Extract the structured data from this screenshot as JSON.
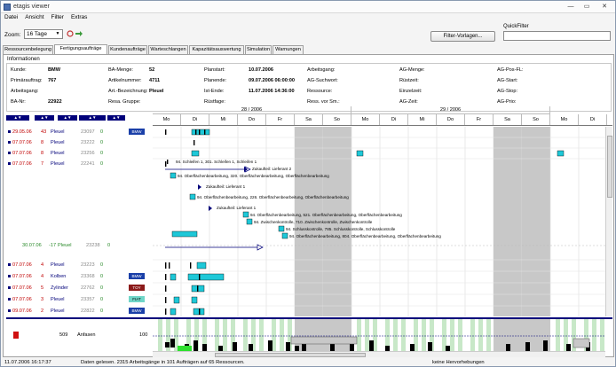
{
  "window": {
    "title": "etagis viewer",
    "min": "—",
    "max": "▭",
    "close": "✕"
  },
  "menu": [
    "Datei",
    "Ansicht",
    "Filter",
    "Extras"
  ],
  "toolbar": {
    "zoom_label": "Zoom:",
    "zoom_value": "16 Tage",
    "filter_button": "Filter-Vorlagen...",
    "quickfilter_label": "QuickFilter",
    "quickfilter_value": ""
  },
  "tabs": [
    "Ressourcenbelegung",
    "Fertigungsaufträge",
    "Kundenaufträge",
    "Warteschlangen",
    "Kapazitätsauswertung",
    "Simulation",
    "Warnungen"
  ],
  "active_tab": 1,
  "info": {
    "title": "Informationen",
    "col1": [
      {
        "label": "Kunde:",
        "value": "BMW"
      },
      {
        "label": "Primärauftrag:",
        "value": "767"
      },
      {
        "label": "Arbeitsgang:",
        "value": ""
      },
      {
        "label": "BA-Nr:",
        "value": "22922"
      }
    ],
    "col2": [
      {
        "label": "BA-Menge:",
        "value": "52"
      },
      {
        "label": "Artikelnummer:",
        "value": "4711"
      },
      {
        "label": "Art.-Bezeichnung:",
        "value": "Pleuel"
      },
      {
        "label": "Resa. Gruppe:",
        "value": ""
      }
    ],
    "col3": [
      {
        "label": "Planstart:",
        "value": "10.07.2006"
      },
      {
        "label": "Planende:",
        "value": "09.07.2006 06:00:00"
      },
      {
        "label": "Ist-Ende:",
        "value": "11.07.2006 14:36:00"
      },
      {
        "label": "Rüstfage:",
        "value": ""
      }
    ],
    "col4": [
      {
        "label": "Arbeitsgang:",
        "value": ""
      },
      {
        "label": "AG-Suchwort:",
        "value": ""
      },
      {
        "label": "Ressource:",
        "value": ""
      },
      {
        "label": "Ress. vor Sm.:",
        "value": ""
      }
    ],
    "col5": [
      {
        "label": "AG-Menge:",
        "value": ""
      },
      {
        "label": "Rüstzeit:",
        "value": ""
      },
      {
        "label": "Einzelzeit:",
        "value": ""
      },
      {
        "label": "AG-Zeit:",
        "value": ""
      }
    ],
    "col6": [
      {
        "label": "AG-Pos-FL:",
        "value": ""
      },
      {
        "label": "AG-Start:",
        "value": ""
      },
      {
        "label": "AG-Stop:",
        "value": ""
      },
      {
        "label": "AG-Prio:",
        "value": ""
      }
    ]
  },
  "col_headers": [
    "▲▼",
    "▲▼",
    "▲▼",
    "▲▼",
    "▲▼"
  ],
  "weeks": [
    "28 / 2006",
    "29 / 2006"
  ],
  "days": [
    "Mo",
    "Di",
    "Mi",
    "Do",
    "Fr",
    "Sa",
    "So",
    "Mo",
    "Di",
    "Mi",
    "Do",
    "Fr",
    "Sa",
    "So",
    "Mo",
    "Di"
  ],
  "rows": [
    {
      "date": "29.05.06",
      "qty": "43",
      "name": "Pleuel",
      "ba": "23097",
      "count": "0",
      "cust": "BMW",
      "custColor": "#1a3fa8"
    },
    {
      "date": "07.07.06",
      "qty": "8",
      "name": "Pleuel",
      "ba": "23222",
      "count": "0",
      "cust": "",
      "custColor": ""
    },
    {
      "date": "07.07.06",
      "qty": "8",
      "name": "Pleuel",
      "ba": "23256",
      "count": "0",
      "cust": "",
      "custColor": ""
    },
    {
      "date": "07.07.06",
      "qty": "7",
      "name": "Pleuel",
      "ba": "22241",
      "count": "0",
      "cust": "",
      "custColor": ""
    }
  ],
  "subrow": {
    "date": "30.07.06",
    "qty": "-17",
    "name": "Pleuel",
    "ba": "23238",
    "count": "0"
  },
  "rows2": [
    {
      "date": "07.07.06",
      "qty": "4",
      "name": "Pleuel",
      "ba": "23223",
      "count": "0",
      "cust": "",
      "custColor": ""
    },
    {
      "date": "07.07.06",
      "qty": "4",
      "name": "Kolben",
      "ba": "23368",
      "count": "0",
      "cust": "BMW",
      "custColor": "#1a3fa8"
    },
    {
      "date": "07.07.06",
      "qty": "5",
      "name": "Zylinder",
      "ba": "22762",
      "count": "0",
      "cust": "TOY",
      "custColor": "#8b1a1a"
    },
    {
      "date": "07.07.06",
      "qty": "3",
      "name": "Pleuel",
      "ba": "23357",
      "count": "0",
      "cust": "FIAT",
      "custColor": "#6fd6c8"
    },
    {
      "date": "09.07.06",
      "qty": "2",
      "name": "Pleuel",
      "ba": "22822",
      "count": "0",
      "cust": "BMW",
      "custColor": "#1a3fa8"
    }
  ],
  "ops": [
    "94. Schleifen 1, 301. Schleifen 1, Schleifen 1",
    "Zukaufteil: Lieferant 2",
    "94. Oberflächenbearbeitung, 320. Oberflächenbearbeitung, Oberflächenbearbeitung",
    "Zukaufteil: Lieferant 1",
    "94. Oberflächenbearbeitung, 226. Oberflächenbearbeitung, Oberflächenbearbeitung",
    "Zukaufteil: Lieferant 1",
    "94. Oberflächenbearbeitung, 521. Oberflächenbearbeitung, Oberflächenbearbeitung",
    "94. Zwischenkontrolle, 710. Zwischenkontrolle, Zwischenkontrolle",
    "94. Schlusskontrolle, 785. Schlusskontrolle, Schlusskontrolle",
    "94. Oberflächenbearbeitung, 804. Oberflächenbearbeitung, Oberflächenbearbeitung"
  ],
  "hist_left": {
    "num": "509",
    "label": "Anfasen",
    "max": "100"
  },
  "status": {
    "time": "11.07.2006 16:17:37",
    "msg": "Daten gelesen. 2315 Arbeitsgänge in 101 Aufträgen auf 65 Ressourcen.",
    "right": "keine Hervorhebungen"
  }
}
